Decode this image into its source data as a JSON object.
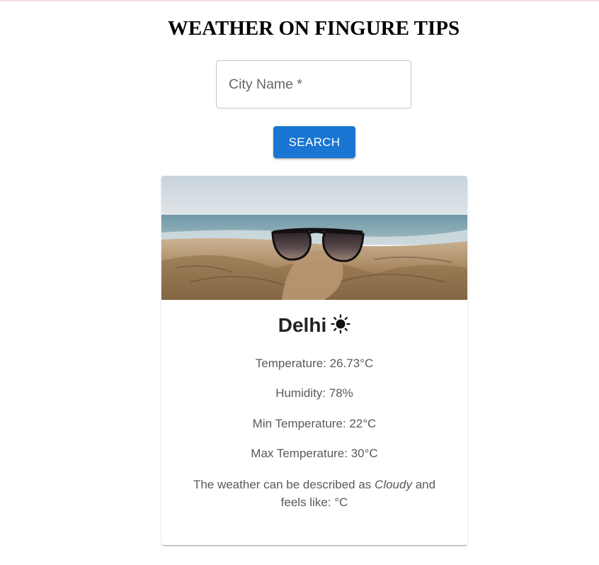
{
  "page": {
    "title": "WEATHER ON FINGURE TIPS"
  },
  "search": {
    "label": "City Name *",
    "value": "",
    "button_label": "SEARCH"
  },
  "card": {
    "image_alt": "sunglasses on beach sand",
    "city": "Delhi",
    "weather_icon": "sun-icon",
    "temperature": "Temperature: 26.73°C",
    "humidity": "Humidity: 78%",
    "min_temperature": "Min Temperature: 22°C",
    "max_temperature": "Max Temperature: 30°C",
    "description_prefix": "The weather can be described as ",
    "description_condition": "Cloudy",
    "description_middle": " and",
    "description_suffix": "feels like: °C"
  },
  "colors": {
    "accent": "#1976d2",
    "title": "#000000",
    "text": "#5a5a5a"
  }
}
